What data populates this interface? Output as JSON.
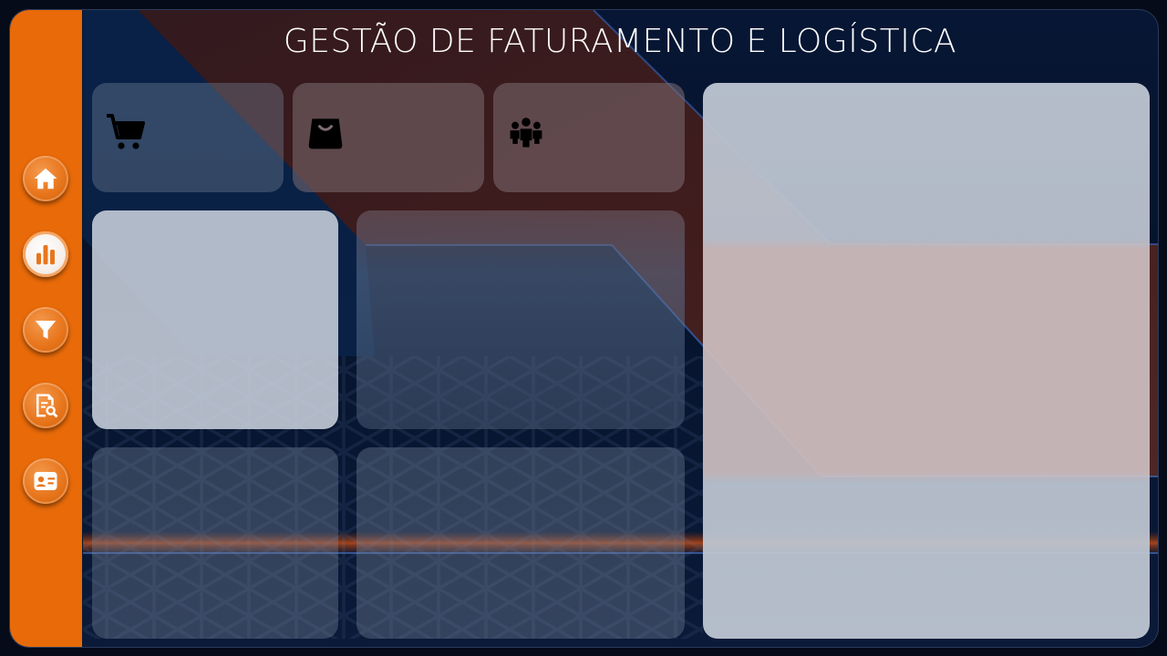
{
  "header": {
    "title": "GESTÃO DE FATURAMENTO E LOGÍSTICA"
  },
  "sidebar": {
    "items": [
      {
        "name": "home",
        "icon": "home-icon",
        "active": false
      },
      {
        "name": "dashboard",
        "icon": "bar-chart-icon",
        "active": true
      },
      {
        "name": "filter",
        "icon": "filter-icon",
        "active": false
      },
      {
        "name": "report",
        "icon": "report-search-icon",
        "active": false
      },
      {
        "name": "contact",
        "icon": "id-card-icon",
        "active": false
      }
    ]
  },
  "kpis": [
    {
      "icon": "cart-icon"
    },
    {
      "icon": "shopping-bag-icon"
    },
    {
      "icon": "people-group-icon"
    }
  ],
  "colors": {
    "sidebar": "#e86a09",
    "background": "#071634",
    "accent_stripe": "#c2521b",
    "title": "#ffffff"
  }
}
